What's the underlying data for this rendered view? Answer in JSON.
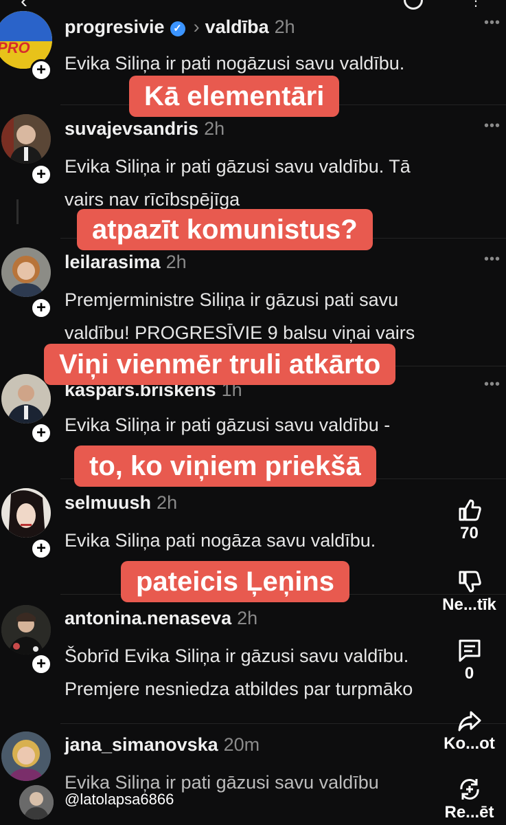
{
  "posts": [
    {
      "username": "progresivie",
      "verified": true,
      "topic": "valdība",
      "time": "2h",
      "lines": [
        "Evika Siliņa ir pati nogāzusi savu valdību."
      ]
    },
    {
      "username": "suvajevsandris",
      "time": "2h",
      "lines": [
        "Evika Siliņa ir pati gāzusi savu valdību. Tā",
        "vairs nav rīcībspējīga"
      ]
    },
    {
      "username": "leilarasima",
      "time": "2h",
      "lines": [
        "Premjerministre Siliņa ir gāzusi pati savu",
        "valdību! PROGRESĪVIE 9 balsu viņai vairs"
      ]
    },
    {
      "username": "kaspars.briskens",
      "time": "1h",
      "lines": [
        "Evika Siliņa ir pati gāzusi savu valdību -"
      ]
    },
    {
      "username": "selmuush",
      "time": "2h",
      "lines": [
        "Evika Siliņa pati nogāza savu valdību."
      ]
    },
    {
      "username": "antonina.nenaseva",
      "time": "2h",
      "lines": [
        "Šobrīd Evika Siliņa ir gāzusi savu valdību.",
        "Premjere nesniedza atbildes par turpmāko"
      ]
    },
    {
      "username": "jana_simanovska",
      "time": "20m",
      "lines": [
        "Evika Siliņa ir pati gāzusi savu valdību"
      ]
    }
  ],
  "avatar_badge": "PRO",
  "captions": [
    "Kā elementāri",
    "atpazīt komunistus?",
    "Viņi vienmēr truli atkārto",
    "to, ko viņiem priekšā",
    "pateicis Ļeņins"
  ],
  "rail": {
    "likes": "70",
    "dislike_label": "Ne...tīk",
    "comments": "0",
    "share_label": "Ko...ot",
    "remix_label": "Re...ēt"
  },
  "footer": {
    "handle": "@latolapsa6866"
  },
  "icons": {
    "back": "chevron-left-icon",
    "search": "search-icon",
    "more": "more-vertical-icon",
    "like": "thumbs-up-icon",
    "dislike": "thumbs-down-icon",
    "comment": "comment-icon",
    "share": "share-icon",
    "remix": "remix-icon"
  },
  "colors": {
    "background": "#0d0d0e",
    "caption": "#e85a4f",
    "verified": "#3b94ff"
  }
}
